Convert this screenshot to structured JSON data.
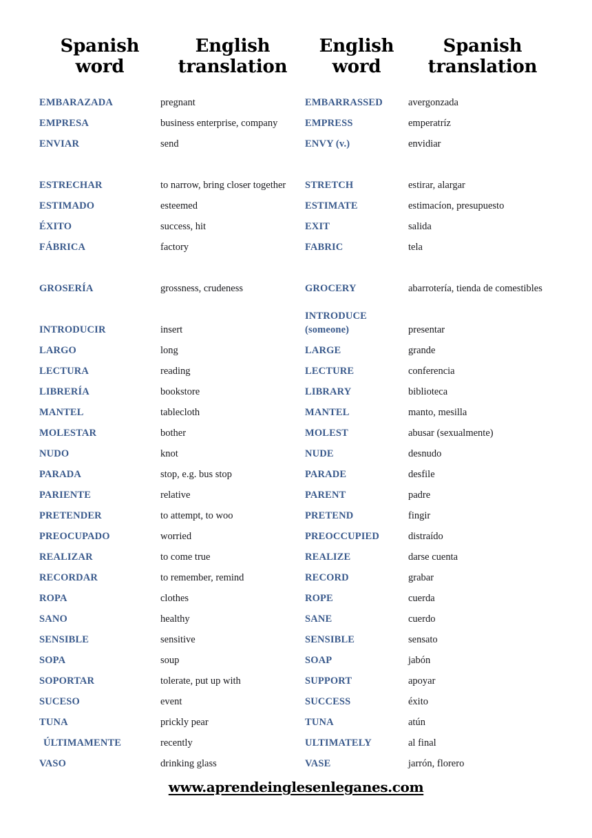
{
  "page": {
    "background_color": "#ffffff",
    "accent_color": "#3a5a8c",
    "text_color": "#18181c"
  },
  "table": {
    "headers": [
      {
        "line1": "Spanish",
        "line2": "word"
      },
      {
        "line1": "English",
        "line2": "translation"
      },
      {
        "line1": "English",
        "line2": "word"
      },
      {
        "line1": "Spanish",
        "line2": "translation"
      }
    ],
    "rows": [
      {
        "spanish_word": "EMBARAZADA",
        "english_translation": "pregnant",
        "english_word": "EMBARRASSED",
        "spanish_translation": "avergonzada"
      },
      {
        "spanish_word": "EMPRESA",
        "english_translation": "business enterprise, company",
        "english_word": "EMPRESS",
        "spanish_translation": "emperatríz"
      },
      {
        "spanish_word": "ENVIAR",
        "english_translation": "send",
        "english_word": "ENVY (v.)",
        "spanish_translation": "envidiar"
      },
      {
        "spanish_word": "ESTRECHAR",
        "english_translation": "to narrow, bring closer together",
        "english_word": "STRETCH",
        "spanish_translation": "estirar, alargar",
        "tall": true
      },
      {
        "spanish_word": "ESTIMADO",
        "english_translation": "esteemed",
        "english_word": "ESTIMATE",
        "spanish_translation": "estimacíon, presupuesto"
      },
      {
        "spanish_word": "ÉXITO",
        "english_translation": "success, hit",
        "english_word": "EXIT",
        "spanish_translation": "salida"
      },
      {
        "spanish_word": "FÁBRICA",
        "english_translation": "factory",
        "english_word": "FABRIC",
        "spanish_translation": "tela"
      },
      {
        "spanish_word": "GROSERÍA",
        "english_translation": "grossness, crudeness",
        "english_word": "GROCERY",
        "spanish_translation": "abarrotería, tienda de comestibles",
        "tall": true
      },
      {
        "spanish_word": "INTRODUCIR",
        "english_translation": "insert",
        "english_word": "INTRODUCE (someone)",
        "spanish_translation": "presentar",
        "tall": true
      },
      {
        "spanish_word": "LARGO",
        "english_translation": "long",
        "english_word": "LARGE",
        "spanish_translation": "grande"
      },
      {
        "spanish_word": "LECTURA",
        "english_translation": "reading",
        "english_word": "LECTURE",
        "spanish_translation": "conferencia"
      },
      {
        "spanish_word": "LIBRERÍA",
        "english_translation": "bookstore",
        "english_word": "LIBRARY",
        "spanish_translation": "biblioteca"
      },
      {
        "spanish_word": "MANTEL",
        "english_translation": "tablecloth",
        "english_word": "MANTEL",
        "spanish_translation": "manto, mesilla"
      },
      {
        "spanish_word": "MOLESTAR",
        "english_translation": "bother",
        "english_word": "MOLEST",
        "spanish_translation": "abusar (sexualmente)"
      },
      {
        "spanish_word": "NUDO",
        "english_translation": "knot",
        "english_word": "NUDE",
        "spanish_translation": "desnudo"
      },
      {
        "spanish_word": "PARADA",
        "english_translation": "stop, e.g. bus stop",
        "english_word": "PARADE",
        "spanish_translation": "desfile"
      },
      {
        "spanish_word": "PARIENTE",
        "english_translation": "relative",
        "english_word": "PARENT",
        "spanish_translation": "padre"
      },
      {
        "spanish_word": "PRETENDER",
        "english_translation": "to attempt, to woo",
        "english_word": "PRETEND",
        "spanish_translation": "fingir"
      },
      {
        "spanish_word": "PREOCUPADO",
        "english_translation": "worried",
        "english_word": "PREOCCUPIED",
        "spanish_translation": "distraído"
      },
      {
        "spanish_word": "REALIZAR",
        "english_translation": "to come true",
        "english_word": "REALIZE",
        "spanish_translation": "darse cuenta"
      },
      {
        "spanish_word": "RECORDAR",
        "english_translation": "to remember, remind",
        "english_word": "RECORD",
        "spanish_translation": "grabar"
      },
      {
        "spanish_word": "ROPA",
        "english_translation": "clothes",
        "english_word": "ROPE",
        "spanish_translation": "cuerda"
      },
      {
        "spanish_word": "SANO",
        "english_translation": "healthy",
        "english_word": "SANE",
        "spanish_translation": "cuerdo"
      },
      {
        "spanish_word": "SENSIBLE",
        "english_translation": "sensitive",
        "english_word": "SENSIBLE",
        "spanish_translation": "sensato"
      },
      {
        "spanish_word": "SOPA",
        "english_translation": "soup",
        "english_word": "SOAP",
        "spanish_translation": "jabón"
      },
      {
        "spanish_word": "SOPORTAR",
        "english_translation": "tolerate, put up with",
        "english_word": "SUPPORT",
        "spanish_translation": "apoyar"
      },
      {
        "spanish_word": "SUCESO",
        "english_translation": "event",
        "english_word": "SUCCESS",
        "spanish_translation": "éxito"
      },
      {
        "spanish_word": "TUNA",
        "english_translation": "prickly pear",
        "english_word": "TUNA",
        "spanish_translation": "atún"
      },
      {
        "spanish_word": "ÚLTIMAMENTE",
        "english_translation": "recently",
        "english_word": "ULTIMATELY",
        "spanish_translation": "al final",
        "indent": true
      },
      {
        "spanish_word": "VASO",
        "english_translation": "drinking glass",
        "english_word": "VASE",
        "spanish_translation": "jarrón, florero"
      }
    ]
  },
  "footer": {
    "website": "www.aprendeinglesenleganes.com"
  }
}
